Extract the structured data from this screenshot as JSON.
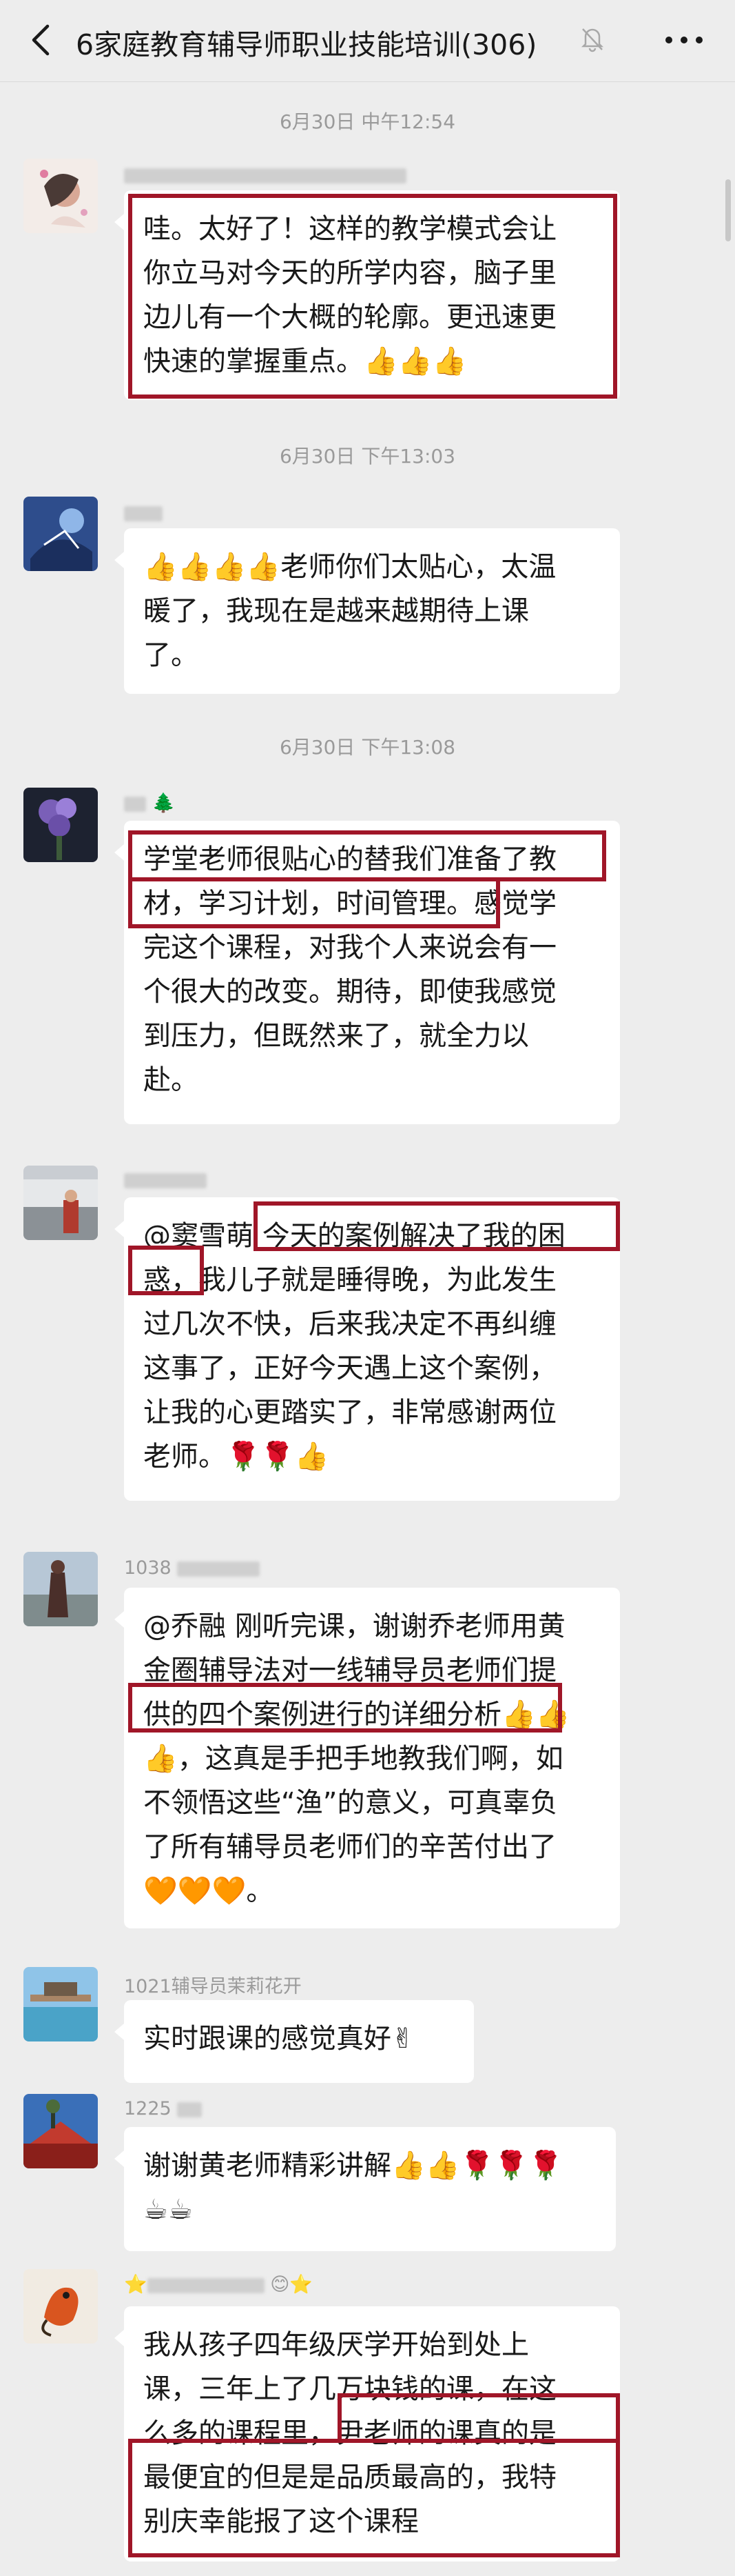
{
  "header": {
    "title": "6家庭教育辅导师职业技能培训(306)",
    "icons": {
      "back": "chevron-left-icon",
      "mute": "bell-mute-icon",
      "more": "ellipsis-icon"
    }
  },
  "timestamps": [
    "6月30日 中午12:54",
    "6月30日 下午13:03",
    "6月30日 下午13:08"
  ],
  "messages": [
    {
      "sender": "",
      "text": "哇。太好了！这样的教学模式会让\n你立马对今天的所学内容，脑子里\n边儿有一个大概的轮廓。更迅速更\n快速的掌握重点。👍👍👍"
    },
    {
      "sender": "",
      "text": "👍👍👍👍老师你们太贴心，太温\n暖了，我现在是越来越期待上课\n了。"
    },
    {
      "sender": "🌲",
      "text": "学堂老师很贴心的替我们准备了教\n材，学习计划，时间管理。感觉学\n完这个课程，对我个人来说会有一\n个很大的改变。期待，即使我感觉\n到压力，但既然来了，就全力以\n赴。"
    },
    {
      "sender": "",
      "text": "@窦雪萌  今天的案例解决了我的困\n惑，我儿子就是睡得晚，为此发生\n过几次不快，后来我决定不再纠缠\n这事了，正好今天遇上这个案例，\n让我的心更踏实了，非常感谢两位\n老师。🌹🌹👍"
    },
    {
      "sender": "1038",
      "text": "@乔融  刚听完课，谢谢乔老师用黄\n金圈辅导法对一线辅导员老师们提\n供的四个案例进行的详细分析👍👍\n👍，这真是手把手地教我们啊，如\n不领悟这些“渔”的意义，可真辜负\n了所有辅导员老师们的辛苦付出了\n🧡🧡🧡。"
    },
    {
      "sender": "1021辅导员茉莉花开",
      "text": "实时跟课的感觉真好✌"
    },
    {
      "sender": "1225",
      "text": "谢谢黄老师精彩讲解👍👍🌹🌹🌹\n☕☕"
    },
    {
      "sender": "😊",
      "text": "我从孩子四年级厌学开始到处上\n课，三年上了几万块钱的课，在这\n么多的课程里，尹老师的课真的是\n最便宜的但是是品质最高的，我特\n别庆幸能报了这个课程"
    }
  ],
  "colors": {
    "background": "#ededed",
    "bubble": "#ffffff",
    "highlight": "#a01628",
    "timestamp": "#9a9a9a"
  }
}
